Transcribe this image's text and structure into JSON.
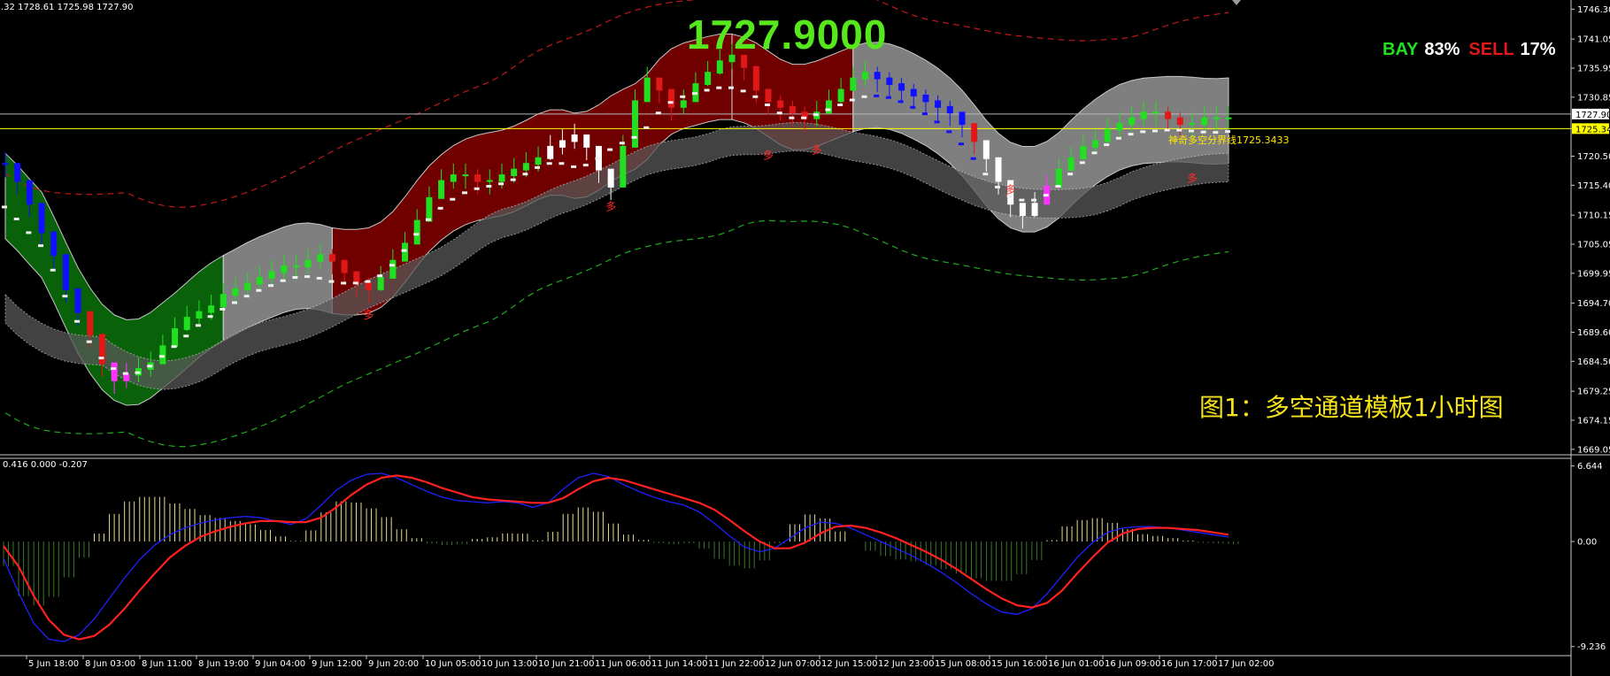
{
  "header": {
    "ohlc_text": ".32 1728.61 1725.98 1727.90",
    "big_price": "1727.9000",
    "bay_label": "BAY",
    "bay_pct": "83%",
    "sell_label": "SELL",
    "sell_pct": "17%",
    "caption": "图1：多空通道模板1小时图",
    "divider_label": "神奇多空分界线1725.3433",
    "macd_header": "0.416 0.000 -0.207",
    "price_tag_current": "1727.90",
    "price_tag_divider": "1725.34",
    "signal_char": "多"
  },
  "colors": {
    "background": "#000000",
    "bull_candle": "#20e020",
    "bear_candle": "#e01818",
    "white_candle": "#ffffff",
    "magenta_candle": "#ff33ff",
    "blue_candle": "#1010ff",
    "green_channel": "#0a6a0a",
    "red_channel": "#7a0000",
    "gray_channel": "#8a8a8a",
    "dark_gray_band": "#585858",
    "divider_line": "#ffff00",
    "macd_line": "#ff2020",
    "signal_line": "#2020ff",
    "hist_pos": "#e8e090",
    "hist_neg": "#3a7a2a"
  },
  "chart_data": [
    {
      "type": "line",
      "title": "",
      "price_axis_ticks": [
        "1746.30",
        "1741.05",
        "1735.95",
        "1730.85",
        "1725.34",
        "1720.50",
        "1715.40",
        "1710.15",
        "1705.05",
        "1699.95",
        "1694.70",
        "1689.60",
        "1684.50",
        "1679.25",
        "1674.15",
        "1669.05"
      ],
      "ylim": [
        1668.4,
        1747.6
      ],
      "time_axis_ticks": [
        "5 Jun 18:00",
        "8 Jun 03:00",
        "8 Jun 11:00",
        "8 Jun 19:00",
        "9 Jun 04:00",
        "9 Jun 12:00",
        "9 Jun 20:00",
        "10 Jun 05:00",
        "10 Jun 13:00",
        "10 Jun 21:00",
        "11 Jun 06:00",
        "11 Jun 14:00",
        "11 Jun 22:00",
        "12 Jun 07:00",
        "12 Jun 15:00",
        "12 Jun 23:00",
        "15 Jun 08:00",
        "15 Jun 16:00",
        "16 Jun 01:00",
        "16 Jun 09:00",
        "16 Jun 17:00",
        "17 Jun 02:00"
      ],
      "current_price": 1727.9,
      "divider_price": 1725.34,
      "divider_value": 1725.3433,
      "candles_mid": [
        1719,
        1716,
        1712,
        1707,
        1703,
        1697,
        1693,
        1689,
        1684,
        1681,
        1682,
        1683,
        1684,
        1687,
        1690,
        1692,
        1693,
        1694,
        1696,
        1697,
        1698,
        1699,
        1700,
        1701,
        1701,
        1702,
        1703,
        1702,
        1700,
        1698,
        1697,
        1699,
        1702,
        1705,
        1709,
        1713,
        1716,
        1717,
        1717,
        1716,
        1716,
        1717,
        1718,
        1719,
        1720,
        1722,
        1723,
        1724,
        1722,
        1718,
        1715,
        1722,
        1730,
        1734,
        1732,
        1729,
        1730,
        1733,
        1735,
        1737,
        1738,
        1736,
        1732,
        1730,
        1729,
        1728,
        1727,
        1728,
        1730,
        1732,
        1734,
        1735,
        1734,
        1733,
        1732,
        1731,
        1730,
        1729,
        1728,
        1726,
        1723,
        1720,
        1716,
        1712,
        1710,
        1712,
        1715,
        1718,
        1720,
        1722,
        1723,
        1725,
        1726,
        1727,
        1728,
        1728,
        1727,
        1726,
        1726,
        1727,
        1727,
        1727
      ]
    },
    {
      "type": "line",
      "title": "",
      "axis_ticks": [
        "6.644",
        "0.00",
        "-9.236"
      ],
      "ylim": [
        -9.8,
        7.0
      ],
      "series": [
        {
          "values": [
            -1.5,
            -4.5,
            -7.2,
            -8.6,
            -8.8,
            -8.2,
            -6.8,
            -5.0,
            -3.2,
            -1.6,
            -0.3,
            0.6,
            1.2,
            1.6,
            1.9,
            2.1,
            2.2,
            2.1,
            1.8,
            1.5,
            2.0,
            3.2,
            4.5,
            5.4,
            5.9,
            6.0,
            5.6,
            5.0,
            4.4,
            3.9,
            3.6,
            3.5,
            3.4,
            3.5,
            3.4,
            3.0,
            3.4,
            4.6,
            5.6,
            6.0,
            5.7,
            5.0,
            4.4,
            3.9,
            3.5,
            3.2,
            2.6,
            1.6,
            0.5,
            -0.5,
            -0.9,
            -0.6,
            0.3,
            1.2,
            1.7,
            1.6,
            1.2,
            0.6,
            0.0,
            -0.6,
            -1.2,
            -1.9,
            -2.7,
            -3.6,
            -4.6,
            -5.5,
            -6.2,
            -6.4,
            -5.9,
            -4.6,
            -3.0,
            -1.4,
            -0.1,
            0.8,
            1.2,
            1.3,
            1.3,
            1.2,
            1.0,
            0.8,
            0.6,
            0.4
          ]
        },
        {
          "values": [
            -0.4,
            -2.2,
            -4.8,
            -6.9,
            -8.2,
            -8.6,
            -8.3,
            -7.3,
            -5.9,
            -4.3,
            -2.8,
            -1.4,
            -0.4,
            0.4,
            0.9,
            1.3,
            1.6,
            1.8,
            1.8,
            1.7,
            1.7,
            2.1,
            3.0,
            4.1,
            5.0,
            5.6,
            5.8,
            5.6,
            5.2,
            4.7,
            4.3,
            3.9,
            3.7,
            3.6,
            3.5,
            3.4,
            3.4,
            3.8,
            4.6,
            5.3,
            5.6,
            5.4,
            5.0,
            4.6,
            4.2,
            3.8,
            3.4,
            2.8,
            1.9,
            0.9,
            0.0,
            -0.6,
            -0.6,
            -0.1,
            0.7,
            1.3,
            1.4,
            1.2,
            0.8,
            0.3,
            -0.3,
            -0.9,
            -1.6,
            -2.4,
            -3.3,
            -4.2,
            -5.0,
            -5.6,
            -5.8,
            -5.4,
            -4.3,
            -2.8,
            -1.4,
            -0.1,
            0.7,
            1.1,
            1.2,
            1.2,
            1.1,
            1.0,
            0.8,
            0.6
          ]
        }
      ]
    }
  ]
}
